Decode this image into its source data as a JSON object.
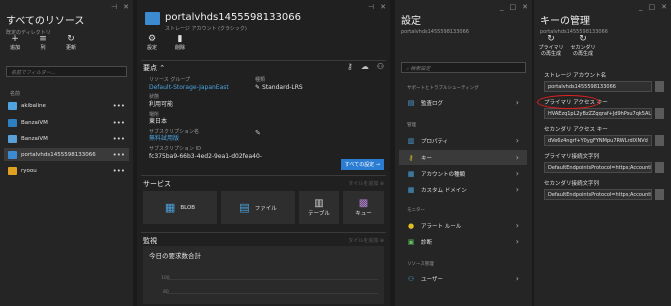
{
  "window_controls": {
    "pin": "⊣",
    "close": "✕",
    "minimize": "_",
    "maximize": "□"
  },
  "blade_resources": {
    "title": "すべてのリソース",
    "subtitle": "既定のディレクトリ",
    "toolbar": [
      {
        "label": "追加",
        "icon": "+"
      },
      {
        "label": "列",
        "icon": "≡"
      },
      {
        "label": "更新",
        "icon": "↻"
      }
    ],
    "filter_placeholder": "名前でフィルター...",
    "column_name": "名前",
    "items": [
      {
        "name": "akibaline",
        "icon_color": "#4fa3e0"
      },
      {
        "name": "BanzaiVM",
        "icon_color": "#2d7fc1"
      },
      {
        "name": "BanzaiVM",
        "icon_color": "#5aa0d8"
      },
      {
        "name": "portalvhds1455598133066",
        "icon_color": "#3c8ad0"
      },
      {
        "name": "ryoou",
        "icon_color": "#e0a020"
      }
    ]
  },
  "blade_storage": {
    "title": "portalvhds1455598133066",
    "subtitle": "ストレージ アカウント (クラシック)",
    "toolbar": [
      {
        "label": "設定",
        "icon": "⚙"
      },
      {
        "label": "削除",
        "icon": "🗑"
      }
    ],
    "essentials_label": "要点",
    "essentials": {
      "resource_group_key": "リソース グループ",
      "resource_group_val": "Default-Storage-JapanEast",
      "status_key": "状態",
      "status_val": "利用可能",
      "location_key": "場所",
      "location_val": "東日本",
      "subscription_key": "サブスクリプション名",
      "subscription_val": "無料試用版",
      "subscription_id_key": "サブスクリプション ID",
      "subscription_id_val": "fc375ba9-66b3-4ed2-9ea1-d02fea40-",
      "type_key": "種類",
      "type_val": "Standard-LRS"
    },
    "all_settings": "すべての設定 →",
    "services_label": "サービス",
    "services_sub": "タイルを追加",
    "services": [
      {
        "label": "BLOB",
        "icon": "▦"
      },
      {
        "label": "ファイル",
        "icon": "▤"
      },
      {
        "label": "テーブル",
        "icon": "▥"
      },
      {
        "label": "キュー",
        "icon": "▩"
      }
    ],
    "monitoring_label": "監視",
    "monitoring_sub": "タイルを追加",
    "monitoring_chart_title": "今日の要求数合計",
    "monitoring_y1": "100",
    "monitoring_y2": "80"
  },
  "blade_settings": {
    "title": "設定",
    "subtitle": "portalvhds1455598133066",
    "search_placeholder": "検索設定",
    "group_support": "サポートとトラブルシューティング",
    "audit_log": "監査ログ",
    "group_manage": "管理",
    "properties": "プロパティ",
    "keys": "キー",
    "account_type": "アカウントの種類",
    "custom_domain": "カスタム ドメイン",
    "group_monitor": "モニター",
    "alert_rules": "アラート ルール",
    "diagnostics": "診断",
    "group_access": "リソース管理",
    "users": "ユーザー"
  },
  "blade_keys": {
    "title": "キーの管理",
    "subtitle": "portalvhds1455598133066",
    "toolbar": [
      {
        "label": "プライマリの再生成",
        "icon": "↻"
      },
      {
        "label": "セカンダリの再生成",
        "icon": "↻"
      }
    ],
    "storage_name_label": "ストレージ アカウント名",
    "storage_name_val": "portalvhds1455598133066",
    "primary_label": "プライマリ アクセス キー",
    "primary_val": "HVAEzq1pL2yBzZZqqraf+Jd9hPsu7qk5AU",
    "secondary_label": "セカンダリ アクセス キー",
    "secondary_val": "dVe6z4ngrf+Y0ygFYNMpu7RWLrdlXNVd",
    "primary_conn_label": "プライマリ接続文字列",
    "primary_conn_val": "DefaultEndpointsProtocol=https;AccountI",
    "secondary_conn_label": "セカンダリ接続文字列",
    "secondary_conn_val": "DefaultEndpointsProtocol=https;AccountI"
  }
}
